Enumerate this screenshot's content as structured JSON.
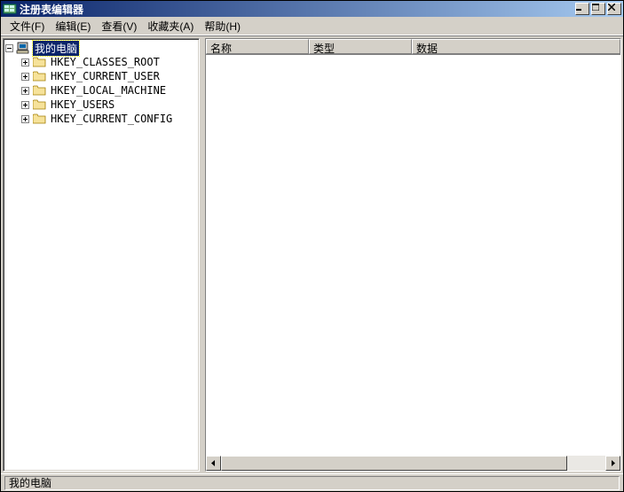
{
  "window": {
    "title": "注册表编辑器"
  },
  "menu": {
    "file": "文件(F)",
    "edit": "编辑(E)",
    "view": "查看(V)",
    "favorites": "收藏夹(A)",
    "help": "帮助(H)"
  },
  "tree": {
    "root_label": "我的电脑",
    "children": [
      {
        "label": "HKEY_CLASSES_ROOT"
      },
      {
        "label": "HKEY_CURRENT_USER"
      },
      {
        "label": "HKEY_LOCAL_MACHINE"
      },
      {
        "label": "HKEY_USERS"
      },
      {
        "label": "HKEY_CURRENT_CONFIG"
      }
    ]
  },
  "list": {
    "columns": {
      "name": "名称",
      "type": "类型",
      "data": "数据"
    }
  },
  "status": {
    "path": "我的电脑"
  },
  "colors": {
    "titlebar_start": "#0a246a",
    "titlebar_end": "#a6caf0",
    "face": "#d4d0c8",
    "selection": "#0a246a"
  }
}
